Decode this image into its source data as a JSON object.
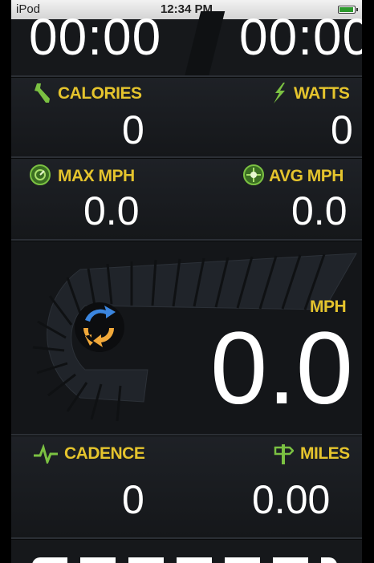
{
  "status_bar": {
    "device": "iPod",
    "time": "12:34 PM",
    "battery_level": 0.95
  },
  "timers": {
    "left": "00:00",
    "right": "00:00"
  },
  "stats": {
    "calories": {
      "label": "CALORIES",
      "value": "0",
      "icon": "wrench-icon"
    },
    "watts": {
      "label": "WATTS",
      "value": "0",
      "icon": "lightning-icon"
    },
    "max_mph": {
      "label": "MAX MPH",
      "value": "0.0",
      "icon": "max-speed-gauge-icon"
    },
    "avg_mph": {
      "label": "AVG MPH",
      "value": "0.0",
      "icon": "avg-speed-gauge-icon"
    },
    "cadence": {
      "label": "CADENCE",
      "value": "0",
      "icon": "heartbeat-icon"
    },
    "miles": {
      "label": "MILES",
      "value": "0.00",
      "icon": "signpost-icon"
    }
  },
  "speed": {
    "label": "MPH",
    "value": "0.0",
    "icon": "refresh-icon"
  },
  "colors": {
    "accent": "#e5c42d",
    "value": "#ffffff",
    "background": "#17191c",
    "icon_green": "#7bc142"
  }
}
